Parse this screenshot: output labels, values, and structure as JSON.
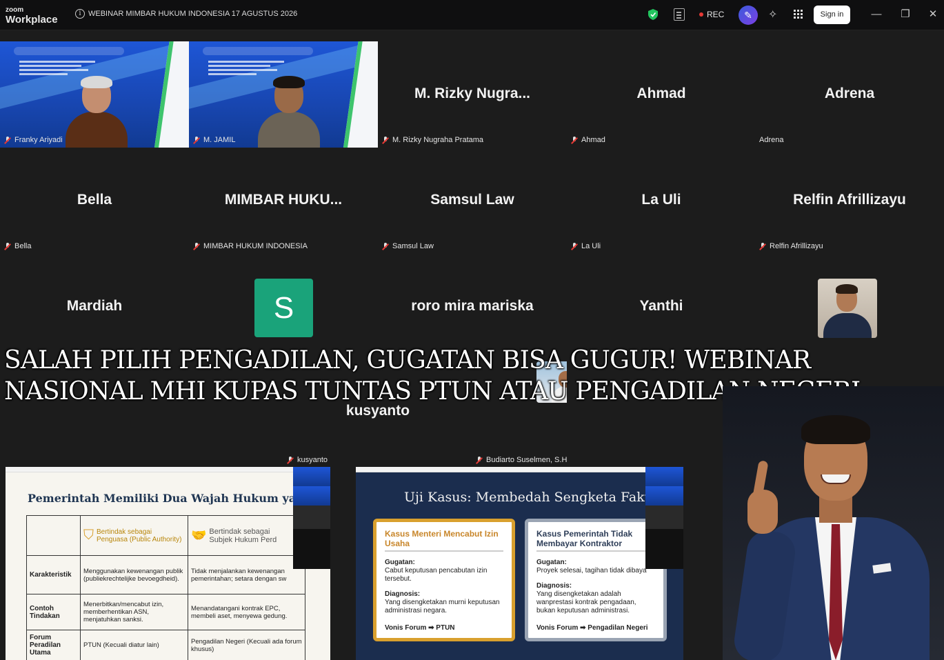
{
  "app": {
    "logo_line1": "zoom",
    "logo_line2": "Workplace",
    "meeting_title": "WEBINAR MIMBAR HUKUM INDONESIA 17 AGUSTUS 2026",
    "rec_label": "REC",
    "sign_in_label": "Sign in",
    "window_controls": [
      "minimize-icon",
      "restore-icon",
      "close-icon"
    ]
  },
  "participants": [
    {
      "display": "",
      "label": "Franky Ariyadi",
      "kind": "video"
    },
    {
      "display": "",
      "label": "M. JAMIL",
      "kind": "video"
    },
    {
      "display": "M. Rizky Nugra...",
      "label": "M. Rizky Nugraha Pratama",
      "kind": "name"
    },
    {
      "display": "Ahmad",
      "label": "Ahmad",
      "kind": "name"
    },
    {
      "display": "Adrena",
      "label": "Adrena",
      "kind": "name"
    },
    {
      "display": "Bella",
      "label": "Bella",
      "kind": "name"
    },
    {
      "display": "MIMBAR HUKU...",
      "label": "MIMBAR HUKUM INDONESIA",
      "kind": "name"
    },
    {
      "display": "Samsul Law",
      "label": "Samsul Law",
      "kind": "name"
    },
    {
      "display": "La Uli",
      "label": "La Uli",
      "kind": "name"
    },
    {
      "display": "Relfin Afrillizayu",
      "label": "Relfin Afrillizayu",
      "kind": "name"
    },
    {
      "display": "Mardiah",
      "label": "Mardiah",
      "kind": "name"
    },
    {
      "display": "S",
      "label": "",
      "kind": "letter"
    },
    {
      "display": "roro mira mariska",
      "label": "",
      "kind": "name"
    },
    {
      "display": "Yanthi",
      "label": "",
      "kind": "name"
    },
    {
      "display": "",
      "label": "",
      "kind": "photo"
    },
    {
      "display": "kusyanto",
      "label": "kusyanto",
      "kind": "name"
    },
    {
      "display": "",
      "label": "Budiarto Suselmen, S.H., CMLC./SWP PT/ BAS LA...",
      "kind": "photo"
    }
  ],
  "headline": {
    "line1": "SALAH PILIH PENGADILAN, GUGATAN BISA GUGUR! WEBINAR",
    "line2": "NASIONAL MHI KUPAS TUNTAS PTUN ATAU PENGADILAN NEGERI"
  },
  "slide_left": {
    "title": "Pemerintah Memiliki Dua Wajah Hukum yang Berbe",
    "col1_header_a": "Bertindak sebagai",
    "col1_header_b": "Penguasa (Public Authority)",
    "col2_header_a": "Bertindak sebagai",
    "col2_header_b": "Subjek Hukum Perd",
    "rows": [
      {
        "head": "Karakteristik",
        "c1": "Menggunakan kewenangan publik (publiekrechtelijke bevoegdheid).",
        "c2": "Tidak menjalankan kewenangan pemerintahan; setara dengan sw"
      },
      {
        "head": "Contoh Tindakan",
        "c1": "Menerbitkan/mencabut izin, memberhentikan ASN, menjatuhkan sanksi.",
        "c2": "Menandatangani kontrak EPC, membeli aset, menyewa gedung."
      },
      {
        "head": "Forum Peradilan Utama",
        "c1": "PTUN (Kecuali diatur lain)",
        "c2": "Pengadilan Negeri (Kecuali ada forum khusus)"
      }
    ]
  },
  "slide_right": {
    "title": "Uji Kasus: Membedah Sengketa Faktual",
    "card1": {
      "title": "Kasus Menteri Mencabut Izin Usaha",
      "gugatan_label": "Gugatan:",
      "gugatan": "Cabut keputusan pencabutan izin tersebut.",
      "diagnosis_label": "Diagnosis:",
      "diagnosis": "Yang disengketakan murni keputusan administrasi negara.",
      "verdict": "Vonis Forum ➡ PTUN"
    },
    "card2": {
      "title": "Kasus Pemerintah Tidak Membayar Kontraktor",
      "gugatan_label": "Gugatan:",
      "gugatan": "Proyek selesai, tagihan tidak dibaya",
      "diagnosis_label": "Diagnosis:",
      "diagnosis": "Yang disengketakan adalah wanprestasi kontrak pengadaan, bukan keputusan administrasi.",
      "verdict": "Vonis Forum ➡ Pengadilan Negeri"
    }
  },
  "colors": {
    "active_speaker": "#2fd27a",
    "letter_avatar": "#1aa37a",
    "rec_dot": "#e53935"
  }
}
